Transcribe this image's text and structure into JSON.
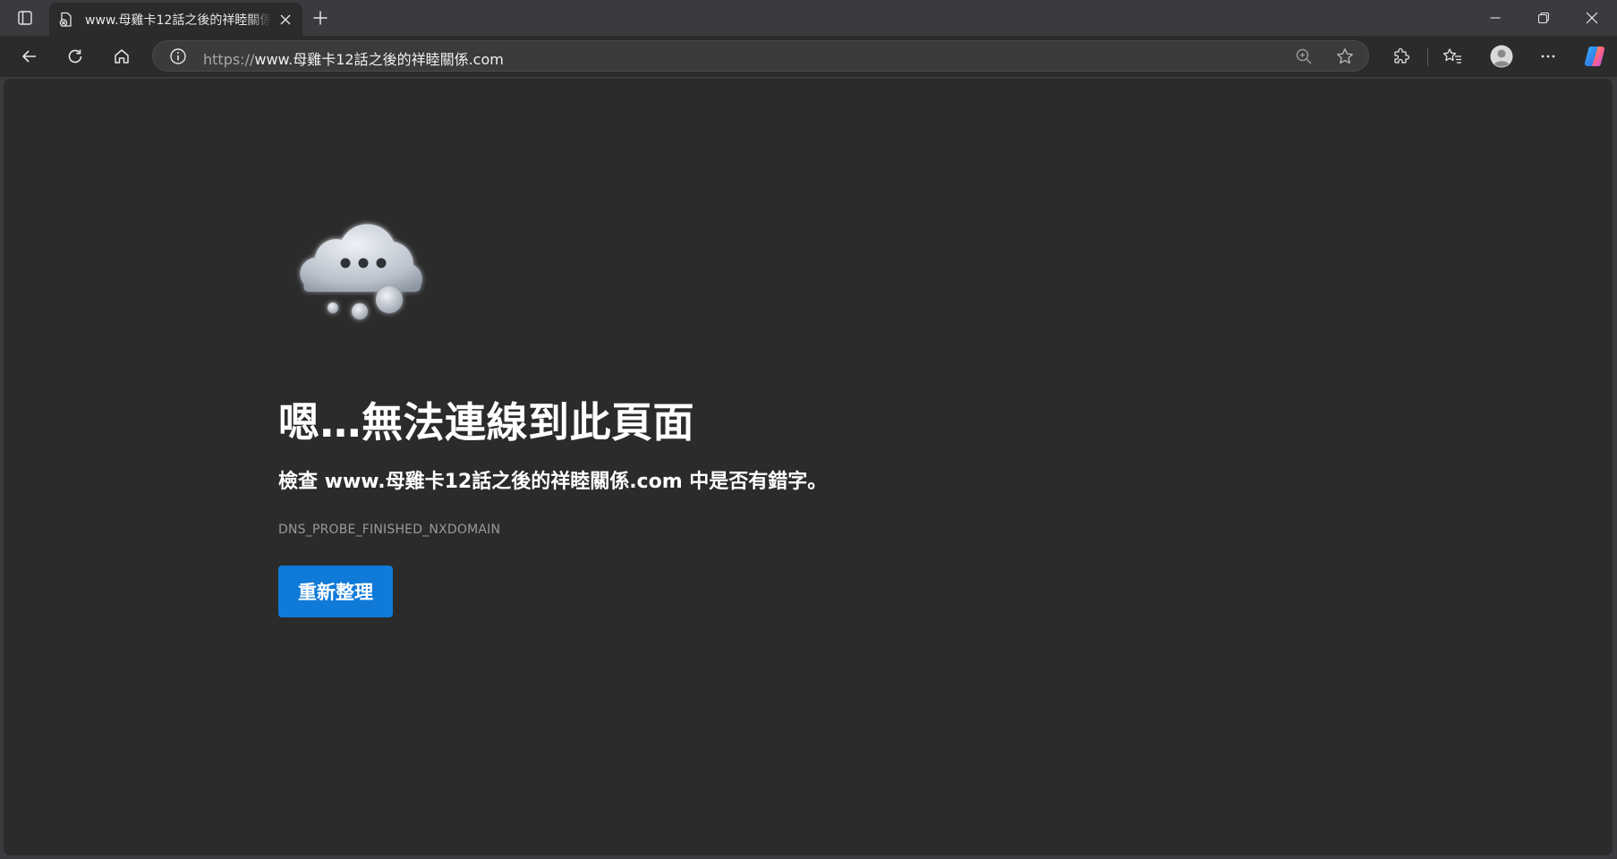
{
  "tab": {
    "title": "www.母雞卡12話之後的祥睦關係.com",
    "favicon": "page-error-icon"
  },
  "toolbar": {
    "url_scheme": "https://",
    "url_host": "www.母雞卡12話之後的祥睦關係.com"
  },
  "icons": {
    "tab_actions": "tab-actions-icon",
    "close_tab": "close-icon",
    "new_tab": "plus-icon",
    "back": "back-arrow-icon",
    "refresh": "refresh-icon",
    "home": "home-icon",
    "site_info": "info-icon",
    "zoom": "zoom-icon",
    "favorite": "star-icon",
    "extensions": "puzzle-icon",
    "favorites": "favorites-list-icon",
    "profile": "avatar",
    "more": "more-icon",
    "copilot": "copilot-icon",
    "minimize": "minimize-icon",
    "restore": "restore-icon",
    "close_window": "close-icon"
  },
  "error_page": {
    "title": "嗯…無法連線到此頁面",
    "description": "檢查 www.母雞卡12話之後的祥睦關係.com 中是否有錯字。",
    "error_code": "DNS_PROBE_FINISHED_NXDOMAIN",
    "refresh_label": "重新整理"
  },
  "colors": {
    "accent": "#0f7ad8",
    "page_background": "#2b2b2b",
    "frame_background": "#3a3b3e"
  }
}
